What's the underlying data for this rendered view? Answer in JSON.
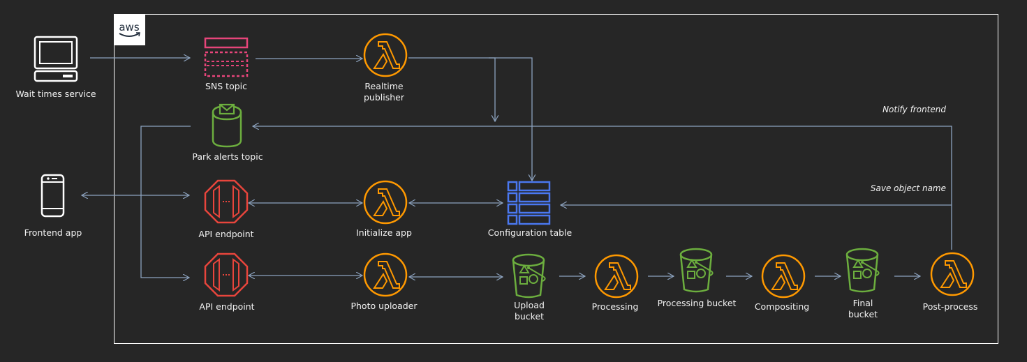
{
  "colors": {
    "background": "#262626",
    "border": "#ffffff",
    "arrow": "#8da3bf",
    "lambda": "#ff9900",
    "sns": "#e7457a",
    "sns_alerts": "#6cae3e",
    "apigw": "#e8453c",
    "dynamodb": "#4a78f0",
    "s3": "#6cae3e"
  },
  "cloud": {
    "logo_text": "aws"
  },
  "nodes": {
    "wait_times": {
      "label": "Wait times service",
      "icon": "desktop-computer-icon"
    },
    "frontend": {
      "label": "Frontend app",
      "icon": "mobile-phone-icon"
    },
    "sns_topic": {
      "label": "SNS topic",
      "icon": "sns-topic-icon"
    },
    "park_alerts": {
      "label": "Park alerts topic",
      "icon": "sns-alerts-icon"
    },
    "api1": {
      "label": "API endpoint",
      "icon": "api-gateway-icon"
    },
    "api2": {
      "label": "API endpoint",
      "icon": "api-gateway-icon"
    },
    "realtime": {
      "label1": "Realtime",
      "label2": "publisher",
      "icon": "lambda-icon"
    },
    "init_app": {
      "label": "Initialize app",
      "icon": "lambda-icon"
    },
    "photo_uploader": {
      "label": "Photo uploader",
      "icon": "lambda-icon"
    },
    "config_table": {
      "label": "Configuration table",
      "icon": "dynamodb-table-icon"
    },
    "upload_bucket": {
      "label1": "Upload",
      "label2": "bucket",
      "icon": "s3-bucket-icon"
    },
    "processing": {
      "label": "Processing",
      "icon": "lambda-icon"
    },
    "processing_bucket": {
      "label": "Processing bucket",
      "icon": "s3-bucket-icon"
    },
    "compositing": {
      "label": "Compositing",
      "icon": "lambda-icon"
    },
    "final_bucket": {
      "label1": "Final",
      "label2": "bucket",
      "icon": "s3-bucket-icon"
    },
    "post_process": {
      "label": "Post-process",
      "icon": "lambda-icon"
    }
  },
  "notes": {
    "notify_frontend": "Notify frontend",
    "save_object_name": "Save object name"
  }
}
